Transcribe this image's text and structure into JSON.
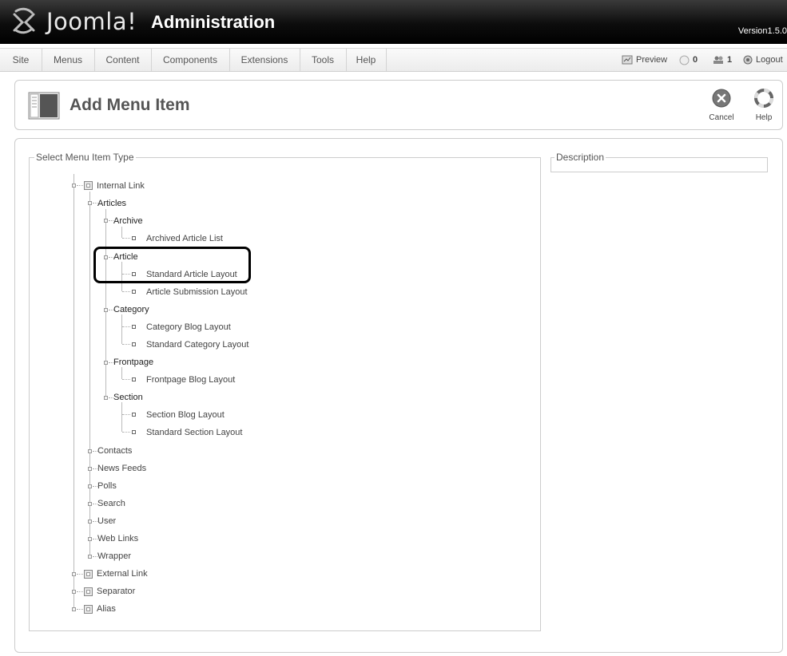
{
  "header": {
    "brand": "Joomla!",
    "title": "Administration",
    "version": "Version1.5.0"
  },
  "menu": [
    "Site",
    "Menus",
    "Content",
    "Components",
    "Extensions",
    "Tools",
    "Help"
  ],
  "status": {
    "preview": "Preview",
    "messages": "0",
    "users": "1",
    "logout": "Logout"
  },
  "toolbar": {
    "page_title": "Add Menu Item",
    "cancel": "Cancel",
    "help": "Help"
  },
  "select_type": {
    "legend": "Select Menu Item Type"
  },
  "description": {
    "legend": "Description"
  },
  "tree": {
    "internal_link": "Internal Link",
    "articles": "Articles",
    "archive": "Archive",
    "archived_article_list": "Archived Article List",
    "article": "Article",
    "standard_article_layout": "Standard Article Layout",
    "article_submission_layout": "Article Submission Layout",
    "category": "Category",
    "category_blog_layout": "Category Blog Layout",
    "standard_category_layout": "Standard Category Layout",
    "frontpage": "Frontpage",
    "frontpage_blog_layout": "Frontpage Blog Layout",
    "section": "Section",
    "section_blog_layout": "Section Blog Layout",
    "standard_section_layout": "Standard Section Layout",
    "contacts": "Contacts",
    "news_feeds": "News Feeds",
    "polls": "Polls",
    "search": "Search",
    "user": "User",
    "web_links": "Web Links",
    "wrapper": "Wrapper",
    "external_link": "External Link",
    "separator": "Separator",
    "alias": "Alias"
  },
  "colors": {
    "header_bg": "#000000",
    "highlight": "#000000"
  }
}
